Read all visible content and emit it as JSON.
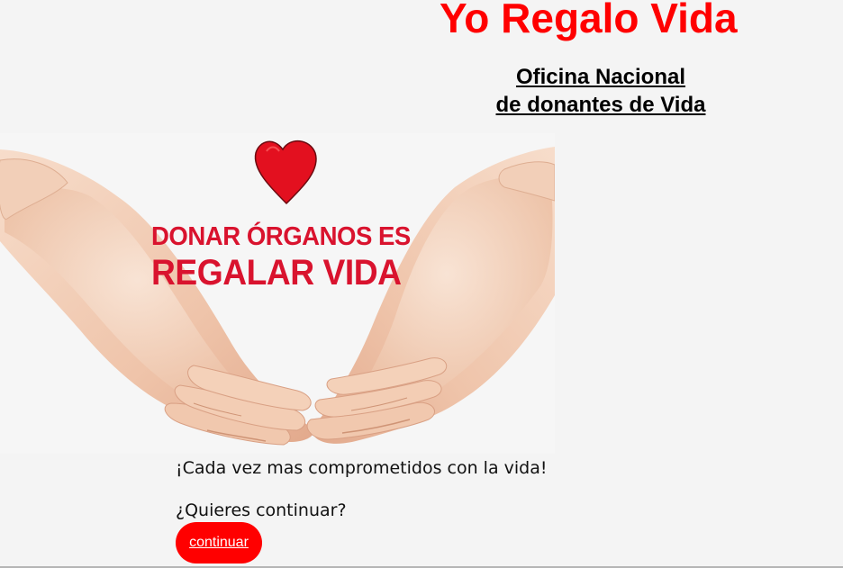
{
  "header": {
    "title": "Yo Regalo Vida",
    "subtitle_line1": "Oficina Nacional",
    "subtitle_line2": "de donantes de Vida"
  },
  "hero": {
    "line1": "DONAR ÓRGANOS ES",
    "line2": "REGALAR VIDA",
    "icon": "heart-icon"
  },
  "main": {
    "tagline": "¡Cada vez mas comprometidos con la vida!",
    "question": "¿Quieres continuar?",
    "continue_label": "continuar"
  },
  "colors": {
    "accent": "#ff0000",
    "hero_text": "#d9132e",
    "background": "#f4f4f4"
  }
}
